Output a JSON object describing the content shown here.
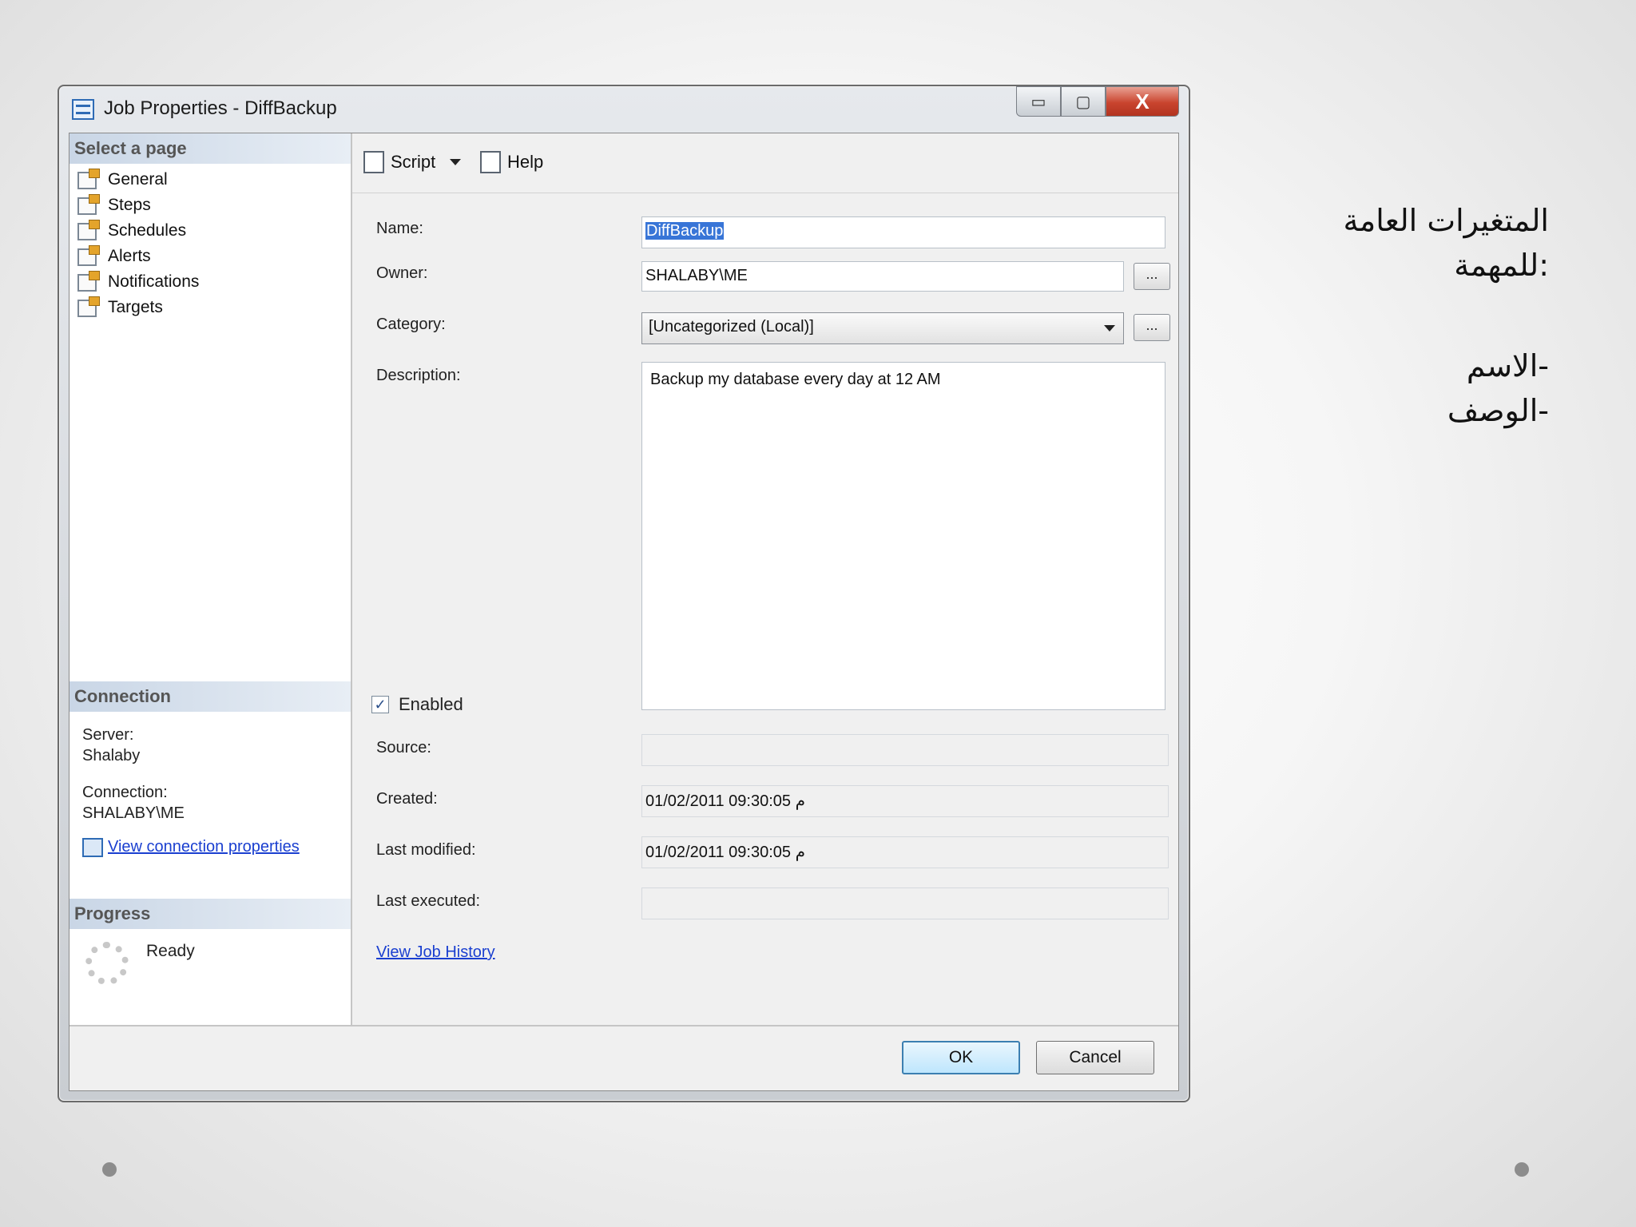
{
  "window": {
    "title": "Job Properties - DiffBackup",
    "minimize": "▭",
    "maximize": "▢",
    "close": "X"
  },
  "sidebar": {
    "header": "Select a page",
    "items": [
      {
        "label": "General",
        "icon": "page-icon"
      },
      {
        "label": "Steps",
        "icon": "page-icon"
      },
      {
        "label": "Schedules",
        "icon": "page-icon"
      },
      {
        "label": "Alerts",
        "icon": "page-icon"
      },
      {
        "label": "Notifications",
        "icon": "page-icon"
      },
      {
        "label": "Targets",
        "icon": "page-icon"
      }
    ]
  },
  "connection": {
    "header": "Connection",
    "server_label": "Server:",
    "server_value": "Shalaby",
    "connection_label": "Connection:",
    "connection_value": "SHALABY\\ME",
    "link": "View connection properties"
  },
  "progress": {
    "header": "Progress",
    "status": "Ready"
  },
  "toolbar": {
    "script_label": "Script",
    "help_label": "Help"
  },
  "form": {
    "name_label": "Name:",
    "name_value": "DiffBackup",
    "owner_label": "Owner:",
    "owner_value": "SHALABY\\ME",
    "category_label": "Category:",
    "category_value": "[Uncategorized (Local)]",
    "browse_label": "...",
    "description_label": "Description:",
    "description_value": "Backup my database every day at 12 AM",
    "enabled_label": "Enabled",
    "enabled_checked": true,
    "check_mark": "✓",
    "source_label": "Source:",
    "source_value": "",
    "created_label": "Created:",
    "created_value": "01/02/2011 09:30:05 م",
    "modified_label": "Last modified:",
    "modified_value": "01/02/2011 09:30:05 م",
    "executed_label": "Last executed:",
    "executed_value": "",
    "job_history_link": "View Job History"
  },
  "buttons": {
    "ok": "OK",
    "cancel": "Cancel"
  },
  "annotation": {
    "line1": "المتغيرات العامة",
    "line2": ":للمهمة",
    "line3": "-الاسم",
    "line4": "-الوصف"
  },
  "colors": {
    "link": "#1a3fd0",
    "selection": "#3875d7",
    "close_button": "#c9442e"
  }
}
